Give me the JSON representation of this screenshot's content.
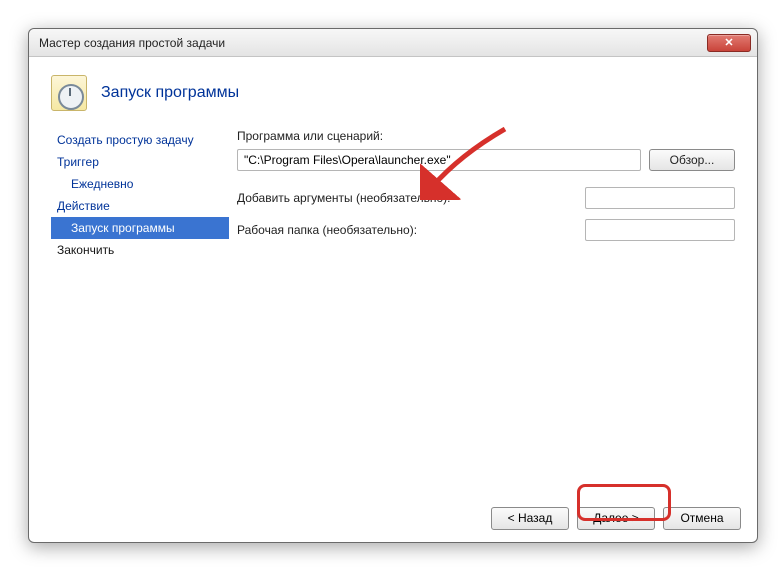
{
  "window": {
    "title": "Мастер создания простой задачи"
  },
  "header": {
    "title": "Запуск программы"
  },
  "sidebar": {
    "items": [
      {
        "label": "Создать простую задачу"
      },
      {
        "label": "Триггер"
      },
      {
        "label": "Ежедневно"
      },
      {
        "label": "Действие"
      },
      {
        "label": "Запуск программы"
      },
      {
        "label": "Закончить"
      }
    ]
  },
  "form": {
    "script_label": "Программа или сценарий:",
    "script_value": "\"C:\\Program Files\\Opera\\launcher.exe\"",
    "browse_label": "Обзор...",
    "args_label": "Добавить аргументы (необязательно):",
    "args_value": "",
    "startin_label": "Рабочая папка (необязательно):",
    "startin_value": ""
  },
  "footer": {
    "back": "< Назад",
    "next": "Далее >",
    "cancel": "Отмена"
  }
}
